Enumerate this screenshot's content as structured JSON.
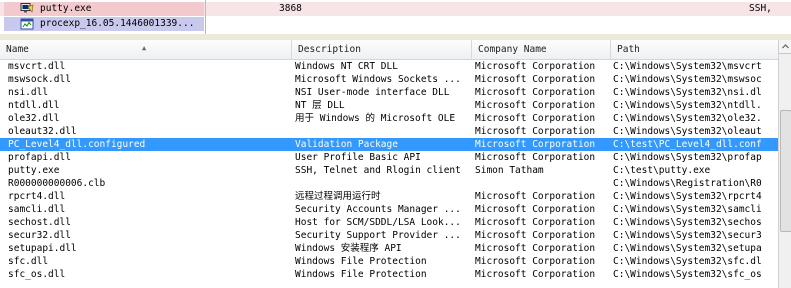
{
  "process_pane": {
    "rows": [
      {
        "name": "putty.exe",
        "pid": "3868",
        "right_text": "SSH,"
      },
      {
        "name": "procexp_16.05.1446001339..."
      }
    ],
    "colors": {
      "row1_bg": "#f2c9cd",
      "row2_bg": "#c9c9ee"
    }
  },
  "dll_table": {
    "columns": [
      "Name",
      "Description",
      "Company Name",
      "Path"
    ],
    "rows": [
      {
        "name": "msvcrt.dll",
        "desc": "Windows NT CRT DLL",
        "company": "Microsoft Corporation",
        "path": "C:\\Windows\\System32\\msvcrt"
      },
      {
        "name": "mswsock.dll",
        "desc": "Microsoft Windows Sockets ...",
        "company": "Microsoft Corporation",
        "path": "C:\\Windows\\System32\\mswsoc"
      },
      {
        "name": "nsi.dll",
        "desc": "NSI User-mode interface DLL",
        "company": "Microsoft Corporation",
        "path": "C:\\Windows\\System32\\nsi.dl"
      },
      {
        "name": "ntdll.dll",
        "desc": "NT 层 DLL",
        "company": "Microsoft Corporation",
        "path": "C:\\Windows\\System32\\ntdll."
      },
      {
        "name": "ole32.dll",
        "desc": "用于 Windows 的 Microsoft OLE",
        "company": "Microsoft Corporation",
        "path": "C:\\Windows\\System32\\ole32."
      },
      {
        "name": "oleaut32.dll",
        "desc": "",
        "company": "Microsoft Corporation",
        "path": "C:\\Windows\\System32\\oleaut"
      },
      {
        "name": "PC_Level4_dll.configured",
        "desc": "Validation Package",
        "company": "Microsoft  Corporation",
        "path": "C:\\test\\PC_Level4_dll.conf"
      },
      {
        "name": "profapi.dll",
        "desc": "User Profile Basic API",
        "company": "Microsoft Corporation",
        "path": "C:\\Windows\\System32\\profap"
      },
      {
        "name": "putty.exe",
        "desc": "SSH, Telnet and Rlogin client",
        "company": "Simon Tatham",
        "path": "C:\\test\\putty.exe"
      },
      {
        "name": "R000000000006.clb",
        "desc": "",
        "company": "",
        "path": "C:\\Windows\\Registration\\R0"
      },
      {
        "name": "rpcrt4.dll",
        "desc": "远程过程调用运行时",
        "company": "Microsoft Corporation",
        "path": "C:\\Windows\\System32\\rpcrt4"
      },
      {
        "name": "samcli.dll",
        "desc": "Security Accounts Manager ...",
        "company": "Microsoft Corporation",
        "path": "C:\\Windows\\System32\\samcli"
      },
      {
        "name": "sechost.dll",
        "desc": "Host for SCM/SDDL/LSA Look...",
        "company": "Microsoft Corporation",
        "path": "C:\\Windows\\System32\\sechos"
      },
      {
        "name": "secur32.dll",
        "desc": "Security Support Provider ...",
        "company": "Microsoft Corporation",
        "path": "C:\\Windows\\System32\\secur3"
      },
      {
        "name": "setupapi.dll",
        "desc": "Windows 安装程序 API",
        "company": "Microsoft Corporation",
        "path": "C:\\Windows\\System32\\setupa"
      },
      {
        "name": "sfc.dll",
        "desc": "Windows File Protection",
        "company": "Microsoft Corporation",
        "path": "C:\\Windows\\System32\\sfc.dl"
      },
      {
        "name": "sfc_os.dll",
        "desc": "Windows File Protection",
        "company": "Microsoft Corporation",
        "path": "C:\\Windows\\System32\\sfc_os"
      }
    ],
    "selected_index": 6,
    "colors": {
      "selected_bg": "#3399ff",
      "selected_fg": "#ffffff"
    }
  },
  "icons": {
    "putty_row_icon": "putty-icon",
    "procexp_row_icon": "procexp-icon",
    "sort_indicator": "sort-ascending-icon"
  }
}
